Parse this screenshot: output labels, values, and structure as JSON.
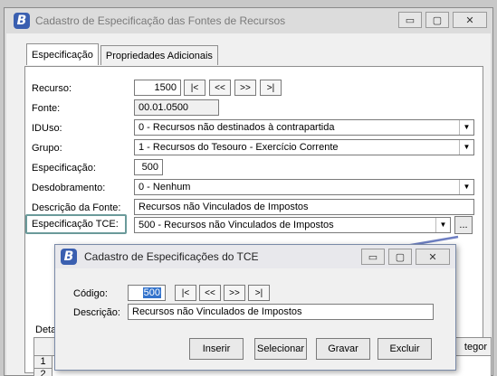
{
  "main_window": {
    "title": "Cadastro de Especificação das Fontes de Recursos",
    "controls": {
      "minimize": "▭",
      "maximize": "▢",
      "close": "✕"
    },
    "tabs": [
      "Especificação",
      "Propriedades Adicionais"
    ],
    "fields": {
      "recurso": {
        "label": "Recurso:",
        "value": "1500"
      },
      "fonte": {
        "label": "Fonte:",
        "value": "00.01.0500"
      },
      "iduso": {
        "label": "IDUso:",
        "value": "0 - Recursos não destinados à contrapartida"
      },
      "grupo": {
        "label": "Grupo:",
        "value": "1 - Recursos do Tesouro - Exercício Corrente"
      },
      "especificacao": {
        "label": "Especificação:",
        "value": "500"
      },
      "desdobramento": {
        "label": "Desdobramento:",
        "value": "0 - Nenhum"
      },
      "descricao_fonte": {
        "label": "Descrição da Fonte:",
        "value": "Recursos não Vinculados de Impostos"
      },
      "especificacao_tce": {
        "label": "Especificação TCE:",
        "value": "500 - Recursos não Vinculados de Impostos",
        "lookup": "..."
      }
    },
    "nav": [
      "|<",
      "<<",
      ">>",
      ">|"
    ],
    "grid": {
      "label": "Detal",
      "col_header": "tegor",
      "rows": [
        "1",
        "2"
      ]
    }
  },
  "dialog": {
    "title": "Cadastro de Especificações do TCE",
    "controls": {
      "minimize": "▭",
      "maximize": "▢",
      "close": "✕"
    },
    "codigo": {
      "label": "Código:",
      "value": "500"
    },
    "descricao": {
      "label": "Descrição:",
      "value": "Recursos não Vinculados de Impostos"
    },
    "nav": [
      "|<",
      "<<",
      ">>",
      ">|"
    ],
    "buttons": [
      "Inserir",
      "Selecionar",
      "Gravar",
      "Excluir"
    ]
  },
  "colors": {
    "accent": "#3a5fb0",
    "highlight_box": "#6a9a9a",
    "selection": "#3373cc",
    "arrow": "#6e7fc2"
  }
}
